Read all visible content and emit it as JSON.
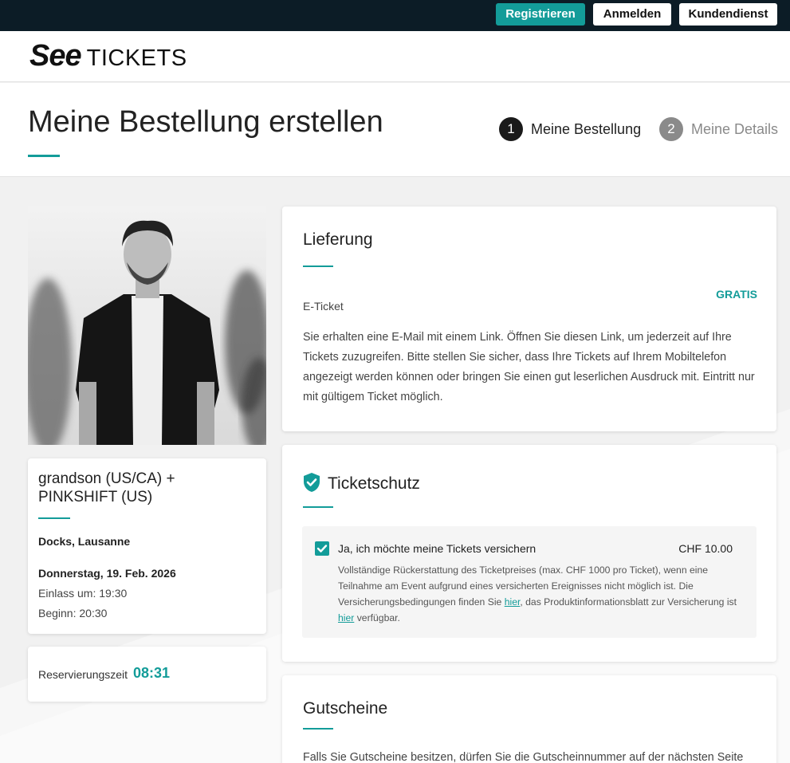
{
  "topbar": {
    "register_label": "Registrieren",
    "login_label": "Anmelden",
    "support_label": "Kundendienst"
  },
  "logo": {
    "part1": "See",
    "part2": "TICKETS"
  },
  "header": {
    "title": "Meine Bestellung erstellen",
    "steps": [
      {
        "number": "1",
        "label": "Meine Bestellung",
        "active": true
      },
      {
        "number": "2",
        "label": "Meine Details",
        "active": false
      }
    ]
  },
  "event": {
    "image_icon": "artist-photo",
    "name": "grandson (US/CA) + PINKSHIFT (US)",
    "venue": "Docks, Lausanne",
    "date": "Donnerstag, 19. Feb. 2026",
    "doors": "Einlass um: 19:30",
    "start": "Beginn: 20:30"
  },
  "reservation": {
    "label": "Reservierungszeit",
    "time": "08:31"
  },
  "delivery": {
    "title": "Lieferung",
    "price": "GRATIS",
    "type": "E-Ticket",
    "description": "Sie erhalten eine E-Mail mit einem Link. Öffnen Sie diesen Link, um jederzeit auf Ihre Tickets zuzugreifen. Bitte stellen Sie sicher, dass Ihre Tickets auf Ihrem Mobiltelefon angezeigt werden können oder bringen Sie einen gut leserlichen Ausdruck mit. Eintritt nur mit gültigem Ticket möglich."
  },
  "insurance": {
    "title": "Ticketschutz",
    "checked": true,
    "label": "Ja, ich möchte meine Tickets versichern",
    "price": "CHF 10.00",
    "desc_part1": "Vollständige Rückerstattung des Ticketpreises (max. CHF 1000 pro Ticket), wenn eine Teilnahme am Event aufgrund eines versicherten Ereignisses nicht möglich ist. Die Versicherungsbedingungen finden Sie ",
    "link1": "hier",
    "desc_part2": ", das Produktinformationsblatt zur Versicherung ist ",
    "link2": "hier",
    "desc_part3": " verfügbar."
  },
  "vouchers": {
    "title": "Gutscheine",
    "text": "Falls Sie Gutscheine besitzen, dürfen Sie die Gutscheinnummer auf der nächsten Seite"
  },
  "colors": {
    "accent": "#139c99",
    "topbar": "#0c1c26",
    "background": "#f1f1f1"
  }
}
